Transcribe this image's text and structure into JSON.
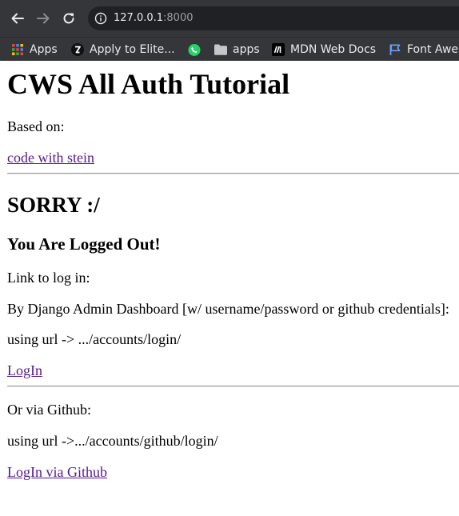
{
  "browser": {
    "url_host": "127.0.0.1",
    "url_port": ":8000",
    "bookmarks": [
      {
        "label": "Apps",
        "icon": "apps-grid-icon"
      },
      {
        "label": "Apply to Elite...",
        "icon": "elite-z-icon"
      },
      {
        "label": "",
        "icon": "whatsapp-icon"
      },
      {
        "label": "apps",
        "icon": "folder-icon"
      },
      {
        "label": "MDN Web Docs",
        "icon": "mdn-icon"
      },
      {
        "label": "Font Awe",
        "icon": "flag-icon"
      }
    ]
  },
  "page": {
    "title": "CWS All Auth Tutorial",
    "based_on_label": "Based on:",
    "based_on_link": "code with stein",
    "sorry_heading": "SORRY :/",
    "logged_out_heading": "You Are Logged Out!",
    "link_intro": "Link to log in:",
    "django_text": "By Django Admin Dashboard [w/ username/password or github credentials]:",
    "login_url_text": "using url -> .../accounts/login/",
    "login_link": "LogIn",
    "github_intro": "Or via Github:",
    "github_url_text": "using url ->.../accounts/github/login/",
    "github_link": "LogIn via Github"
  },
  "colors": {
    "chrome_bg": "#35363a",
    "omnibox_bg": "#202124",
    "visited_link": "#551a8b"
  }
}
